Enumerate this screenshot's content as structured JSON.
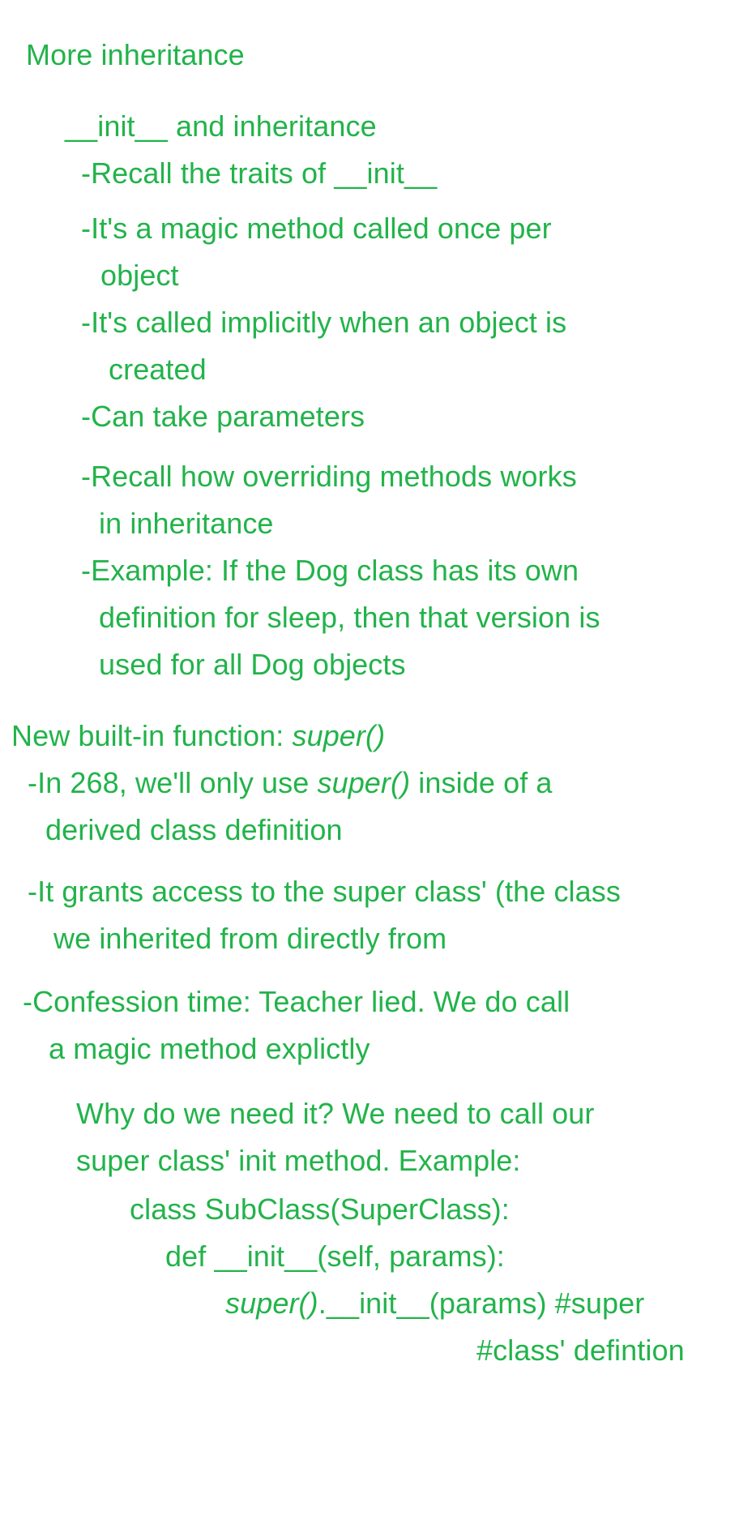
{
  "colors": {
    "text": "#22b34a",
    "background": "#ffffff"
  },
  "notes": {
    "title": "More inheritance",
    "init_section": {
      "heading": "__init__ and inheritance",
      "recall_traits": "-Recall the traits of __init__",
      "magic_method_1": "-It's a magic method called once per",
      "magic_method_2": "object",
      "called_implicitly_1": "-It's called implicitly when an object is",
      "called_implicitly_2": "created",
      "parameters": "-Can take parameters",
      "overriding_1": "-Recall how overriding methods works",
      "overriding_2": "in inheritance",
      "example_1": "-Example: If the Dog class has its own",
      "example_2": "definition for sleep, then that version is",
      "example_3": "used for all Dog objects"
    },
    "super_section": {
      "heading_prefix": "New built-in function:  ",
      "heading_keyword": "super()",
      "usage_prefix": "-In 268, we'll only use ",
      "usage_keyword": "super()",
      "usage_suffix": " inside of a",
      "usage_2": "derived class definition",
      "grants_1": "-It grants access to the super class' (the class",
      "grants_2": "we inherited from directly from",
      "confession_1": "-Confession time: Teacher lied. We do call",
      "confession_2": "a magic method explictly",
      "why_1": "Why do we need it? We need to call our",
      "why_2": "super class' init method. Example:",
      "code_class": "class SubClass(SuperClass):",
      "code_def": "def __init__(self, params):",
      "code_super_keyword": "super()",
      "code_super_rest": ".__init__(params) #super",
      "code_comment": "#class' defintion"
    }
  }
}
